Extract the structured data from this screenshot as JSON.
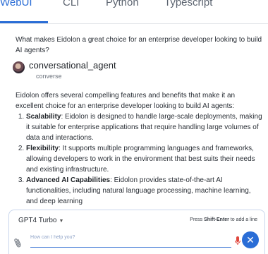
{
  "tabs": [
    {
      "label": "WebUI",
      "active": true
    },
    {
      "label": "CLI",
      "active": false
    },
    {
      "label": "Python",
      "active": false
    },
    {
      "label": "Typescript",
      "active": false
    }
  ],
  "question": "What makes Eidolon a great choice for an enterprise developer looking to build AI agents?",
  "agent": {
    "name": "conversational_agent",
    "action": "converse"
  },
  "answer": {
    "intro": "Eidolon offers several compelling features and benefits that make it an excellent choice for an enterprise developer looking to build AI agents:",
    "items": [
      {
        "title": "Scalability",
        "text": ": Eidolon is designed to handle large-scale deployments, making it suitable for enterprise applications that require handling large volumes of data and interactions."
      },
      {
        "title": "Flexibility",
        "text": ": It supports multiple programming languages and frameworks, allowing developers to work in the environment that best suits their needs and existing infrastructure."
      },
      {
        "title": "Advanced AI Capabilities",
        "text": ": Eidolon provides state-of-the-art AI functionalities, including natural language processing, machine learning, and deep learning"
      }
    ]
  },
  "composer": {
    "model": "GPT4 Turbo",
    "hint_prefix": "Press ",
    "hint_key": "Shift-Enter",
    "hint_suffix": " to add a line",
    "placeholder": "How can I help you?"
  },
  "colors": {
    "accent": "#2a6dd6",
    "mic": "#e0483e"
  },
  "icons": {
    "attach": "paperclip-icon",
    "mic": "microphone-icon",
    "send": "close-icon"
  }
}
